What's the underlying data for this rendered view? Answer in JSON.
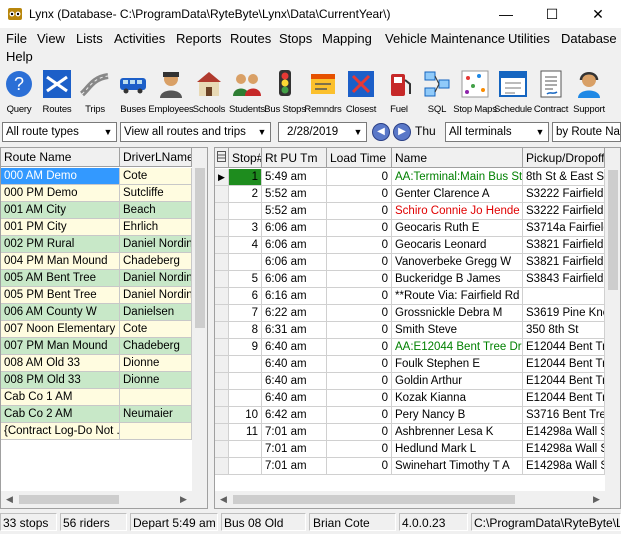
{
  "window": {
    "title": "Lynx  (Database- C:\\ProgramData\\RyteByte\\Lynx\\Data\\CurrentYear\\)",
    "minimize": "—",
    "maximize": "☐",
    "close": "✕"
  },
  "menu": [
    "File",
    "View",
    "Lists",
    "Activities",
    "Reports",
    "Routes",
    "Stops",
    "Mapping",
    "Vehicle Maintenance",
    "Utilities",
    "Database",
    "Help"
  ],
  "toolbar": [
    {
      "label": "Query",
      "icon": "query-icon"
    },
    {
      "label": "Routes",
      "icon": "routes-icon"
    },
    {
      "label": "Trips",
      "icon": "trips-icon"
    },
    {
      "label": "Buses",
      "icon": "buses-icon"
    },
    {
      "label": "Employees",
      "icon": "employees-icon"
    },
    {
      "label": "Schools",
      "icon": "schools-icon"
    },
    {
      "label": "Students",
      "icon": "students-icon"
    },
    {
      "label": "Bus Stops",
      "icon": "bus-stops-icon"
    },
    {
      "label": "Remndrs",
      "icon": "reminders-icon"
    },
    {
      "label": "Closest",
      "icon": "closest-icon"
    },
    {
      "label": "Fuel",
      "icon": "fuel-icon"
    },
    {
      "label": "SQL",
      "icon": "sql-icon"
    },
    {
      "label": "Stop Maps",
      "icon": "stop-maps-icon"
    },
    {
      "label": "Schedule",
      "icon": "schedule-icon"
    },
    {
      "label": "Contract",
      "icon": "contract-icon"
    },
    {
      "label": "Support",
      "icon": "support-icon"
    }
  ],
  "filters": {
    "route_types": "All route types",
    "routes_trips": "View all routes and trips",
    "date": "2/28/2019",
    "day": "Thu",
    "terminals": "All terminals",
    "sort": "by Route Name"
  },
  "left_grid": {
    "columns": [
      "Route Name",
      "DriverLName"
    ],
    "rows": [
      {
        "route": "000 AM Demo",
        "driver": "Cote",
        "selected": true
      },
      {
        "route": "000 PM Demo",
        "driver": "Sutcliffe"
      },
      {
        "route": "001 AM City",
        "driver": "Beach"
      },
      {
        "route": "001 PM City",
        "driver": "Ehrlich"
      },
      {
        "route": "002 PM Rural",
        "driver": "Daniel Nordins"
      },
      {
        "route": "004 PM Man Mound",
        "driver": "Chadeberg"
      },
      {
        "route": "005 AM Bent Tree",
        "driver": "Daniel Nordins"
      },
      {
        "route": "005 PM Bent Tree",
        "driver": "Daniel Nordins"
      },
      {
        "route": "006 AM County W",
        "driver": "Danielsen"
      },
      {
        "route": "007 Noon Elementary",
        "driver": "Cote"
      },
      {
        "route": "007 PM Man Mound",
        "driver": "Chadeberg"
      },
      {
        "route": "008 AM Old 33",
        "driver": "Dionne"
      },
      {
        "route": "008 PM Old 33",
        "driver": "Dionne"
      },
      {
        "route": "Cab Co 1 AM",
        "driver": ""
      },
      {
        "route": "Cab Co 2 AM",
        "driver": "Neumaier"
      },
      {
        "route": "{Contract Log-Do Not ...",
        "driver": ""
      }
    ]
  },
  "right_grid": {
    "columns": [
      "",
      "Stop#",
      "Rt PU Tm",
      "Load Time",
      "Name",
      "Pickup/Dropoff A"
    ],
    "rows": [
      {
        "marker": "▶",
        "stop": "1",
        "time": "5:49 am",
        "load": "0",
        "name": "AA:Terminal:Main Bus St...",
        "addr": "8th St & East St",
        "color": "#008000"
      },
      {
        "marker": "",
        "stop": "2",
        "time": "5:52 am",
        "load": "0",
        "name": "Genter Clarence A",
        "addr": "S3222 Fairfield R"
      },
      {
        "marker": "",
        "stop": "",
        "time": "5:52 am",
        "load": "0",
        "name": "Schiro Connie Jo Hende",
        "addr": "S3222 Fairfield R",
        "color": "#e00000"
      },
      {
        "marker": "",
        "stop": "3",
        "time": "6:06 am",
        "load": "0",
        "name": "Geocaris Ruth E",
        "addr": "S3714a Fairfield"
      },
      {
        "marker": "",
        "stop": "4",
        "time": "6:06 am",
        "load": "0",
        "name": "Geocaris Leonard",
        "addr": "S3821 Fairfield R"
      },
      {
        "marker": "",
        "stop": "",
        "time": "6:06 am",
        "load": "0",
        "name": "Vanoverbeke Gregg W",
        "addr": "S3821 Fairfield R"
      },
      {
        "marker": "",
        "stop": "5",
        "time": "6:06 am",
        "load": "0",
        "name": "Buckeridge B James",
        "addr": "S3843 Fairfield R"
      },
      {
        "marker": "",
        "stop": "6",
        "time": "6:16 am",
        "load": "0",
        "name": "**Route Via: Fairfield Rd",
        "addr": ""
      },
      {
        "marker": "",
        "stop": "7",
        "time": "6:22 am",
        "load": "0",
        "name": "Grossnickle Debra M",
        "addr": "S3619 Pine Kno"
      },
      {
        "marker": "",
        "stop": "8",
        "time": "6:31 am",
        "load": "0",
        "name": "Smith Steve",
        "addr": "350 8th St"
      },
      {
        "marker": "",
        "stop": "9",
        "time": "6:40 am",
        "load": "0",
        "name": "AA:E12044 Bent Tree Dr...",
        "addr": "E12044 Bent Tre",
        "color": "#008000"
      },
      {
        "marker": "",
        "stop": "",
        "time": "6:40 am",
        "load": "0",
        "name": "Foulk Stephen E",
        "addr": "E12044 Bent Tre"
      },
      {
        "marker": "",
        "stop": "",
        "time": "6:40 am",
        "load": "0",
        "name": "Goldin Arthur",
        "addr": "E12044 Bent Tre"
      },
      {
        "marker": "",
        "stop": "",
        "time": "6:40 am",
        "load": "0",
        "name": "Kozak Kianna",
        "addr": "E12044 Bent Tre"
      },
      {
        "marker": "",
        "stop": "10",
        "time": "6:42 am",
        "load": "0",
        "name": "Pery Nancy B",
        "addr": "S3716 Bent Tree"
      },
      {
        "marker": "",
        "stop": "11",
        "time": "7:01 am",
        "load": "0",
        "name": "Ashbrenner Lesa K",
        "addr": "E14298a Wall S"
      },
      {
        "marker": "",
        "stop": "",
        "time": "7:01 am",
        "load": "0",
        "name": "Hedlund Mark L",
        "addr": "E14298a Wall S"
      },
      {
        "marker": "",
        "stop": "",
        "time": "7:01 am",
        "load": "0",
        "name": "Swinehart Timothy T A",
        "addr": "E14298a Wall S"
      }
    ]
  },
  "status": {
    "stops": "33 stops",
    "riders": "56 riders",
    "depart": "Depart 5:49 am",
    "bus": "Bus 08 Old",
    "driver": "Brian Cote",
    "version": "4.0.0.23",
    "path": "C:\\ProgramData\\RyteByte\\Lynx\\Data\\CurrentYear\\"
  },
  "colors": {
    "selected_row": "#3399ff",
    "left_row_alt": "#c8e8c8",
    "left_row": "#fffce0",
    "stop_highlight": "#1e8c1e"
  }
}
